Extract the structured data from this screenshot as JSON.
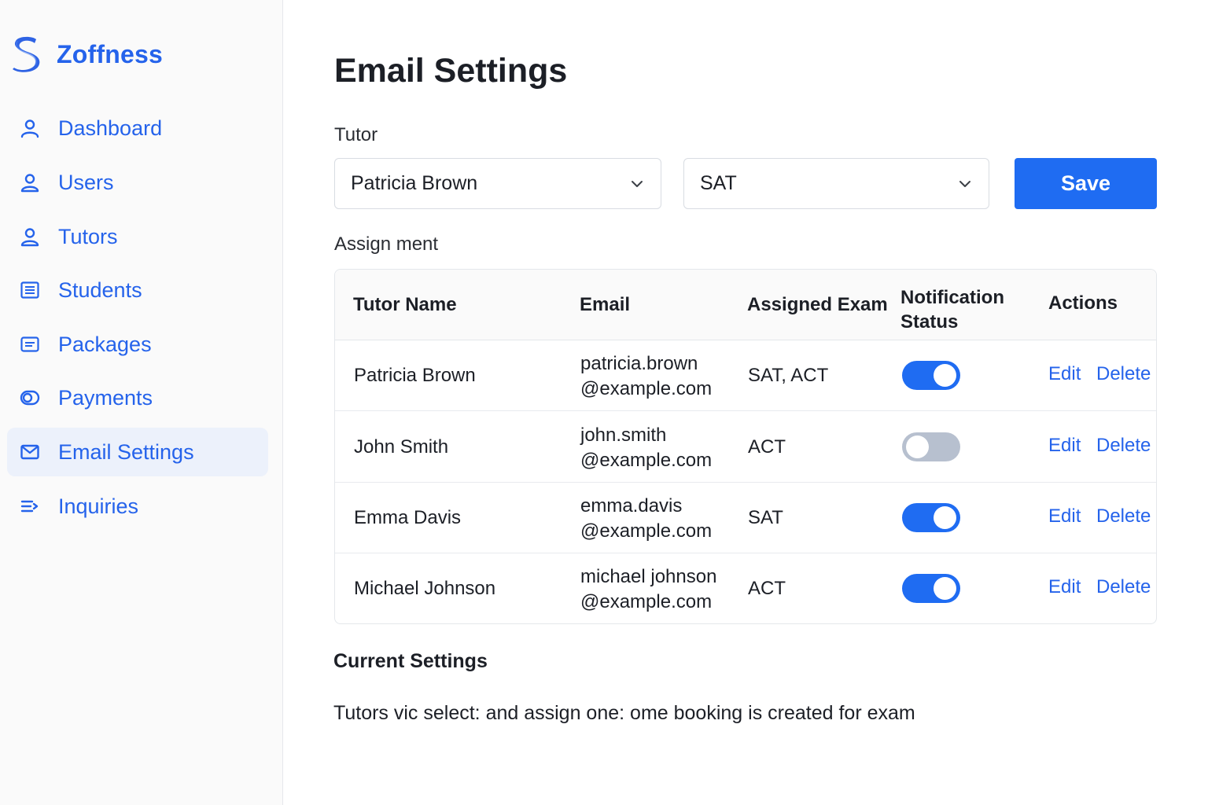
{
  "brand": {
    "name": "Zoffness",
    "logo_icon": "s-logo-icon",
    "color": "#2563eb"
  },
  "sidebar": {
    "items": [
      {
        "label": "Dashboard",
        "icon": "user-icon",
        "active": false
      },
      {
        "label": "Users",
        "icon": "user-icon",
        "active": false
      },
      {
        "label": "Tutors",
        "icon": "user-icon",
        "active": false
      },
      {
        "label": "Students",
        "icon": "list-icon",
        "active": false
      },
      {
        "label": "Packages",
        "icon": "card-icon",
        "active": false
      },
      {
        "label": "Payments",
        "icon": "coins-icon",
        "active": false
      },
      {
        "label": "Email Settings",
        "icon": "mail-icon",
        "active": true
      },
      {
        "label": "Inquiries",
        "icon": "lines-arrow-icon",
        "active": false
      }
    ]
  },
  "main": {
    "title": "Email Settings",
    "tutor_label": "Tutor",
    "tutor_select": {
      "value": "Patricia Brown"
    },
    "exam_select": {
      "value": "SAT"
    },
    "save_label": "Save",
    "assignment_label": "Assign ment",
    "table": {
      "headers": {
        "name": "Tutor Name",
        "email": "Email",
        "exam": "Assigned Exam",
        "status_line1": "Notification",
        "status_line2": "Status",
        "actions": "Actions"
      },
      "rows": [
        {
          "name": "Patricia Brown",
          "email_user": "patricia.brown",
          "email_domain": "@example.com",
          "exam": "SAT, ACT",
          "notification_on": true,
          "edit": "Edit",
          "delete": "Delete"
        },
        {
          "name": "John Smith",
          "email_user": "john.smith",
          "email_domain": "@example.com",
          "exam": "ACT",
          "notification_on": false,
          "edit": "Edit",
          "delete": "Delete"
        },
        {
          "name": "Emma Davis",
          "email_user": "emma.davis",
          "email_domain": "@example.com",
          "exam": "SAT",
          "notification_on": true,
          "edit": "Edit",
          "delete": "Delete"
        },
        {
          "name": "Michael Johnson",
          "email_user": "michael johnson",
          "email_domain": "@example.com",
          "exam": "ACT",
          "notification_on": true,
          "edit": "Edit",
          "delete": "Delete"
        }
      ]
    },
    "current_settings": {
      "title": "Current Settings",
      "text": "Tutors vic select: and assign one: ome booking is created for exam"
    }
  },
  "colors": {
    "accent": "#1f6cf2",
    "toggle_off": "#b7c0cf",
    "active_nav_bg": "#ecf1fb"
  }
}
